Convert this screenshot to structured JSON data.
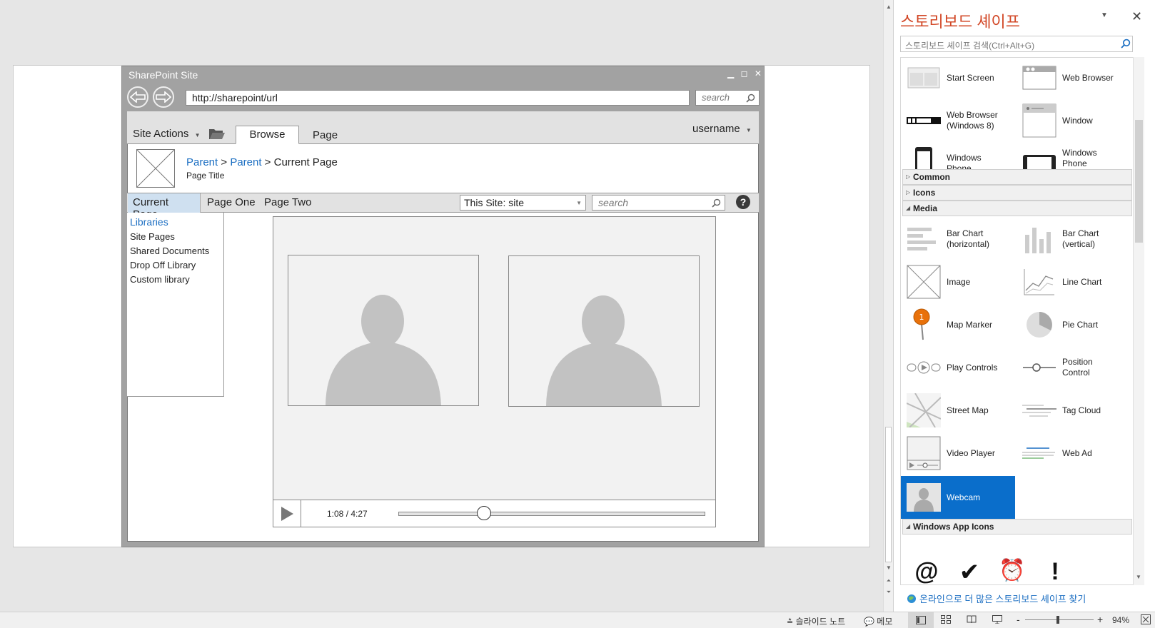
{
  "mockup": {
    "site_title": "SharePoint Site",
    "window_controls": "▁ ◻ ✕",
    "url": "http://sharepoint/url",
    "top_search_placeholder": "search",
    "site_actions": "Site Actions",
    "tab_browse": "Browse",
    "tab_page": "Page",
    "username": "username",
    "breadcrumb": {
      "parent1": "Parent",
      "sep": " > ",
      "parent2": "Parent",
      "current": "Current Page"
    },
    "page_title": "Page Title",
    "quicklaunch": {
      "current": "Current Page",
      "one": "Page One",
      "two": "Page Two"
    },
    "scope_select": "This Site: site",
    "quick_search_placeholder": "search",
    "help": "?",
    "leftnav": {
      "heading": "Libraries",
      "items": [
        "Site Pages",
        "Shared Documents",
        "Drop Off Library",
        "Custom library"
      ]
    },
    "video_time": "1:08 / 4:27",
    "video_progress": 0.28
  },
  "pane": {
    "title": "스토리보드 셰이프",
    "search_placeholder": "스토리보드 셰이프 검색(Ctrl+Alt+G)",
    "top_items": [
      [
        "Start Screen",
        "Web Browser"
      ],
      [
        "Web Browser\n(Windows 8)",
        "Window"
      ],
      [
        "Windows\nPhone",
        "Windows\nPhone\n(landscape)"
      ]
    ],
    "categories": {
      "common": "Common",
      "icons": "Icons",
      "media": "Media",
      "win_app_icons": "Windows App Icons"
    },
    "media_items": [
      [
        "Bar Chart\n(horizontal)",
        "Bar Chart\n(vertical)"
      ],
      [
        "Image",
        "Line Chart"
      ],
      [
        "Map Marker",
        "Pie Chart"
      ],
      [
        "Play Controls",
        "Position\nControl"
      ],
      [
        "Street Map",
        "Tag Cloud"
      ],
      [
        "Video Player",
        "Web Ad"
      ],
      [
        "Webcam",
        ""
      ]
    ],
    "app_icons": [
      "@",
      "✔",
      "⏰",
      "!"
    ],
    "map_marker_badge": "1",
    "online_link": "온라인으로 더 많은 스토리보드 셰이프 찾기"
  },
  "status": {
    "notes": "슬라이드 노트",
    "comments": "메모",
    "zoom_minus": "-",
    "zoom_plus": "+",
    "zoom": "94%"
  },
  "colors": {
    "pane_title": "#d24726",
    "selected": "#0a6ecb",
    "link": "#1b6ec2"
  }
}
